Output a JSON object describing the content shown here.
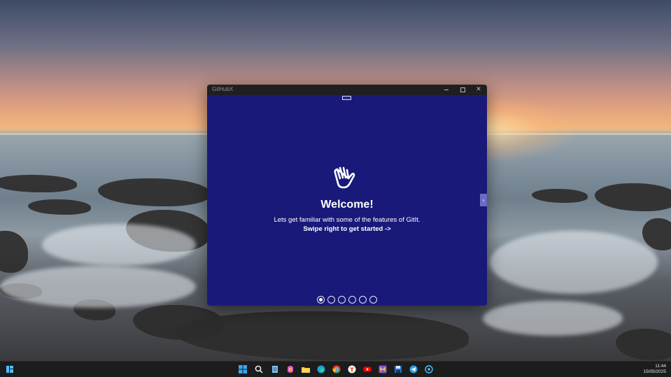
{
  "window": {
    "title": "GitHubX",
    "welcome_heading": "Welcome!",
    "intro_text": "Lets get familiar with some of the features of GitIt.",
    "swipe_text": "Swipe right to get started ->",
    "next_arrow": "›",
    "close_glyph": "✕"
  },
  "pager": {
    "page_count": 6,
    "current_page": 1
  },
  "taskbar": {
    "time": "11:44",
    "date": "15/05/2025",
    "icons": [
      "widgets-icon",
      "start-icon",
      "search-icon",
      "notepad-icon",
      "copilot-icon",
      "file-explorer-icon",
      "edge-icon",
      "chrome-icon",
      "yandex-icon",
      "youtube-icon",
      "app-icon",
      "app-icon-2",
      "save-icon",
      "telegram-icon",
      "github-icon"
    ]
  },
  "colors": {
    "window_bg": "#19197a",
    "titlebar_bg": "#1f1f22",
    "taskbar_bg": "#1c1c1c",
    "accent": "#6c6cc2"
  }
}
